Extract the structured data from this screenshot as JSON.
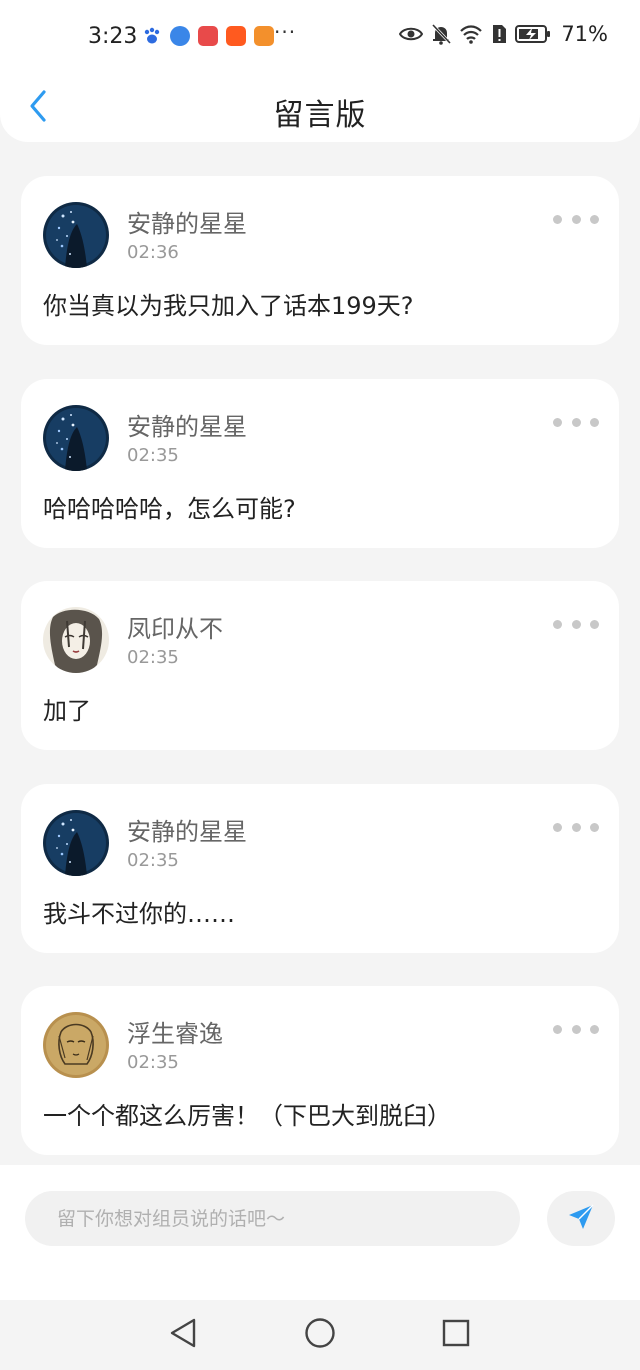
{
  "status_bar": {
    "time": "3:23",
    "more": "···",
    "battery": "71%"
  },
  "header": {
    "title": "留言版"
  },
  "messages": [
    {
      "user": "安静的星星",
      "time": "02:36",
      "text": "你当真以为我只加入了话本199天?"
    },
    {
      "user": "安静的星星",
      "time": "02:35",
      "text": "哈哈哈哈哈，怎么可能?"
    },
    {
      "user": "凤印从不",
      "time": "02:35",
      "text": "加了"
    },
    {
      "user": "安静的星星",
      "time": "02:35",
      "text": "我斗不过你的……"
    },
    {
      "user": "浮生睿逸",
      "time": "02:35",
      "text": "一个个都这么厉害！（下巴大到脱臼）"
    }
  ],
  "composer": {
    "placeholder": "留下你想对组员说的话吧～"
  },
  "colors": {
    "accent": "#2e9bf0",
    "background": "#f4f4f4",
    "card": "#ffffff"
  },
  "icons": {
    "back": "chevron-left-icon",
    "more": "more-dots-icon",
    "send": "paper-plane-icon",
    "nav_back": "triangle-back-icon",
    "nav_home": "circle-home-icon",
    "nav_recent": "square-recent-icon"
  }
}
